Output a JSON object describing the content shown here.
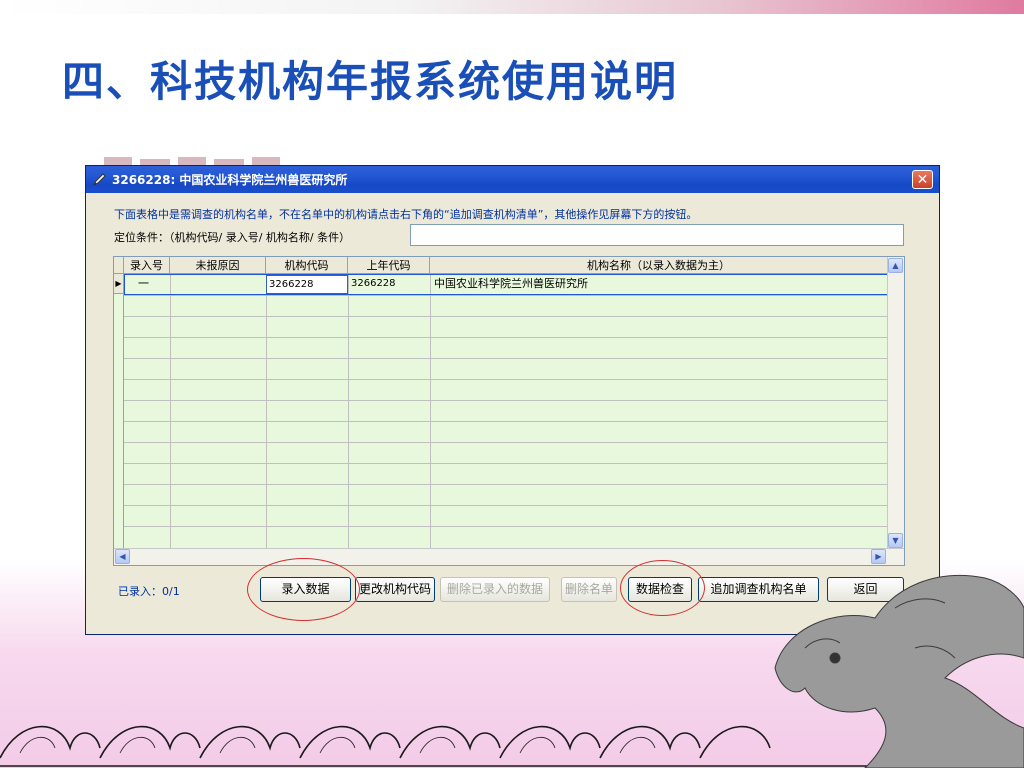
{
  "slide_title": "四、科技机构年报系统使用说明",
  "watermark_text": "科技机构年报",
  "window": {
    "title": "3266228:   中国农业科学院兰州兽医研究所",
    "icon": "pen-icon",
    "close_icon": "close-icon"
  },
  "instruction": "下面表格中是需调查的机构名单，不在名单中的机构请点击右下角的“追加调查机构清单”，其他操作见屏幕下方的按钮。",
  "filter": {
    "label": "定位条件：（机构代码/ 录入号/ 机构名称/ 条件）",
    "value": ""
  },
  "table": {
    "columns": [
      "录入号",
      "未报原因",
      "机构代码",
      "上年代码",
      "机构名称（以录入数据为主）"
    ],
    "rows": [
      {
        "entry_no": "一",
        "reason": "",
        "org_code": "3266228",
        "last_year_code": "3266228",
        "org_name": "中国农业科学院兰州兽医研究所"
      }
    ]
  },
  "status": "已录入：0/1",
  "buttons": {
    "enter_data": "录入数据",
    "change_code": "更改机构代码",
    "delete_entered": "删除已录入的数据",
    "delete_list": "删除名单",
    "check_data": "数据检查",
    "add_org_list": "追加调查机构名单",
    "back": "返回"
  },
  "colors": {
    "title_blue": "#1a4fb8",
    "titlebar": "#2458d4",
    "grid_bg": "#e8f8dc",
    "highlight_ring": "#d23030"
  }
}
